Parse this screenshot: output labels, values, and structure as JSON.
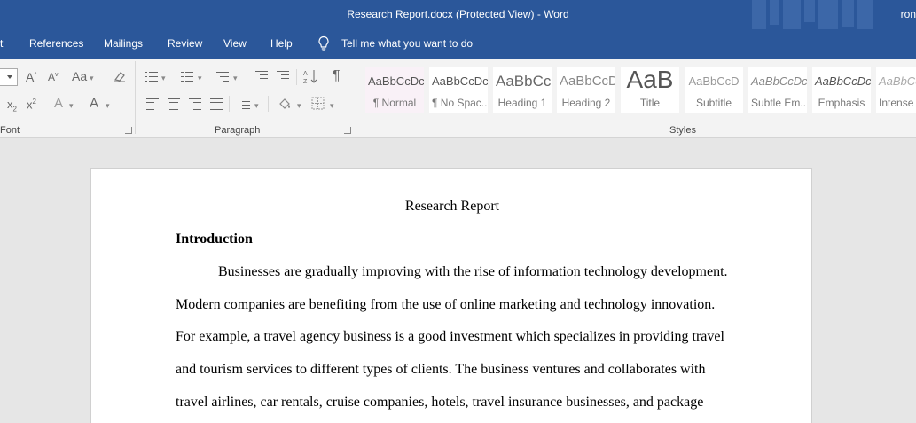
{
  "window": {
    "title": "Research Report.docx (Protected View)  -  Word",
    "user": "ron"
  },
  "tabs": [
    {
      "label": "t"
    },
    {
      "label": "References"
    },
    {
      "label": "Mailings"
    },
    {
      "label": "Review"
    },
    {
      "label": "View"
    },
    {
      "label": "Help"
    }
  ],
  "tell_me": {
    "label": "Tell me what you want to do"
  },
  "ribbon": {
    "font_group": {
      "label": "Font",
      "grow_font": "A",
      "shrink_font": "A",
      "change_case": "Aa",
      "subscript": "x",
      "subscript_mark": "2",
      "superscript": "x",
      "superscript_mark": "2",
      "text_effects": "A",
      "font_color": "A"
    },
    "paragraph_group": {
      "label": "Paragraph"
    },
    "styles_group": {
      "label": "Styles",
      "items": [
        {
          "sample": "AaBbCcDc",
          "name": "¶ Normal"
        },
        {
          "sample": "AaBbCcDc",
          "name": "¶ No Spac..."
        },
        {
          "sample": "AaBbCc",
          "name": "Heading 1"
        },
        {
          "sample": "AaBbCcD",
          "name": "Heading 2"
        },
        {
          "sample": "AaB",
          "name": "Title"
        },
        {
          "sample": "AaBbCcD",
          "name": "Subtitle"
        },
        {
          "sample": "AaBbCcDc",
          "name": "Subtle Em..."
        },
        {
          "sample": "AaBbCcDc",
          "name": "Emphasis"
        },
        {
          "sample": "AaBbCcDc",
          "name": "Intense"
        }
      ]
    }
  },
  "document": {
    "title": "Research Report",
    "heading": "Introduction",
    "lines": [
      "Businesses are gradually improving with the rise of information technology development.",
      "Modern companies are benefiting from the use of online marketing and technology innovation.",
      "For example, a travel agency business is a good investment which specializes in providing travel",
      "and tourism services to different types of clients. The business ventures and collaborates with",
      "travel airlines, car rentals, cruise companies, hotels, travel insurance businesses, and package"
    ]
  }
}
